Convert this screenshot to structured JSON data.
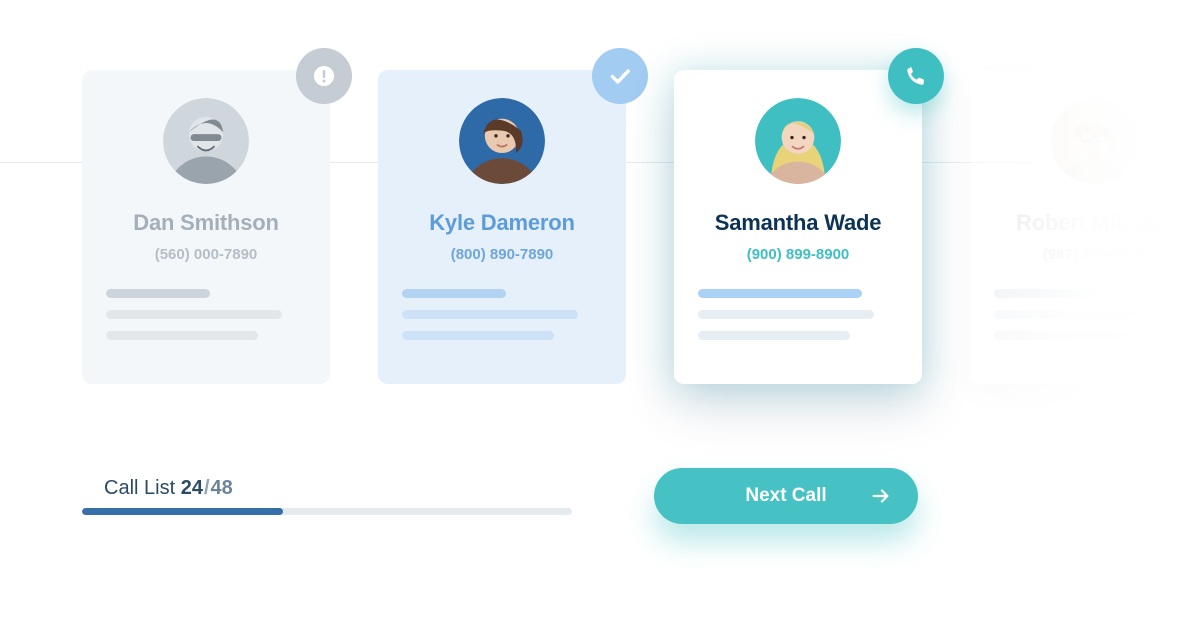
{
  "cards": [
    {
      "name": "Dan Smithson",
      "phone": "(560) 000-7890",
      "status": "alert"
    },
    {
      "name": "Kyle Dameron",
      "phone": "(800) 890-7890",
      "status": "done"
    },
    {
      "name": "Samantha Wade",
      "phone": "(900) 899-8900",
      "status": "active"
    },
    {
      "name": "Robert Milligan",
      "phone": "(987) 499-8900",
      "status": "upcoming"
    }
  ],
  "progress": {
    "label_prefix": "Call List ",
    "current": "24",
    "total": "48",
    "percent": 41
  },
  "cta": {
    "label": "Next Call"
  },
  "colors": {
    "teal": "#3fbfc2",
    "navy": "#0c3355",
    "track": "#e5eaef",
    "fill": "#376fa8"
  }
}
